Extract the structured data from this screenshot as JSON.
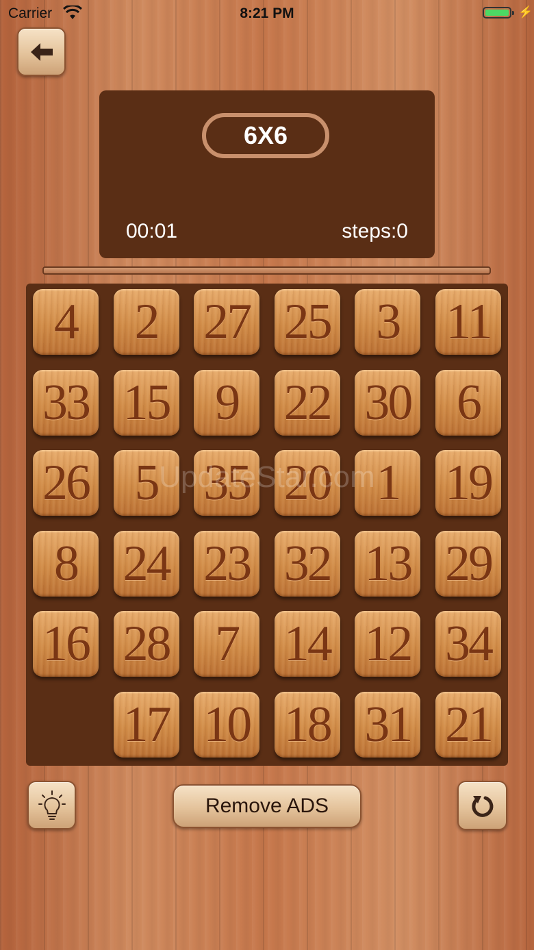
{
  "status_bar": {
    "carrier": "Carrier",
    "time": "8:21 PM"
  },
  "panel": {
    "grid_size": "6X6",
    "timer": "00:01",
    "steps": "steps:0"
  },
  "board": {
    "rows": 6,
    "cols": 6,
    "tiles": [
      "4",
      "2",
      "27",
      "25",
      "3",
      "11",
      "33",
      "15",
      "9",
      "22",
      "30",
      "6",
      "26",
      "5",
      "35",
      "20",
      "1",
      "19",
      "8",
      "24",
      "23",
      "32",
      "13",
      "29",
      "16",
      "28",
      "7",
      "14",
      "12",
      "34",
      "",
      "17",
      "10",
      "18",
      "31",
      "21"
    ]
  },
  "buttons": {
    "remove_ads": "Remove ADS"
  },
  "icons": {
    "back": "arrow-left-icon",
    "hint": "lightbulb-icon",
    "reset": "refresh-icon"
  },
  "watermark": "UpdateStar.com",
  "colors": {
    "panel_bg": "#5a2e15",
    "tile_text": "#7a3614",
    "badge_border": "#c9906c"
  }
}
